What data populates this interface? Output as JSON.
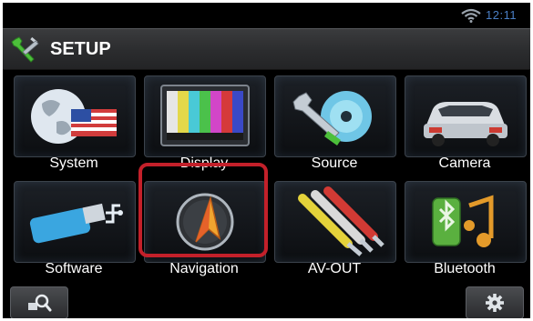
{
  "status_bar": {
    "time": "12:11",
    "wifi_icon": "wifi-icon"
  },
  "header": {
    "title": "SETUP",
    "icon": "wrench-icon"
  },
  "tiles": [
    {
      "label": "System",
      "icon": "globe-flag-icon"
    },
    {
      "label": "Display",
      "icon": "color-bars-monitor-icon"
    },
    {
      "label": "Source",
      "icon": "disc-wrench-icon"
    },
    {
      "label": "Camera",
      "icon": "car-icon"
    },
    {
      "label": "Software",
      "icon": "usb-drive-icon"
    },
    {
      "label": "Navigation",
      "icon": "compass-arrow-icon"
    },
    {
      "label": "AV-OUT",
      "icon": "rca-cables-icon"
    },
    {
      "label": "Bluetooth",
      "icon": "bluetooth-audio-icon"
    }
  ],
  "selected_tile": "Navigation",
  "bottom_bar": {
    "left_icon": "search-icon",
    "right_icon": "gear-icon"
  },
  "colors": {
    "highlight": "#c3202a",
    "clock": "#4a7fc4",
    "background": "#000000"
  }
}
